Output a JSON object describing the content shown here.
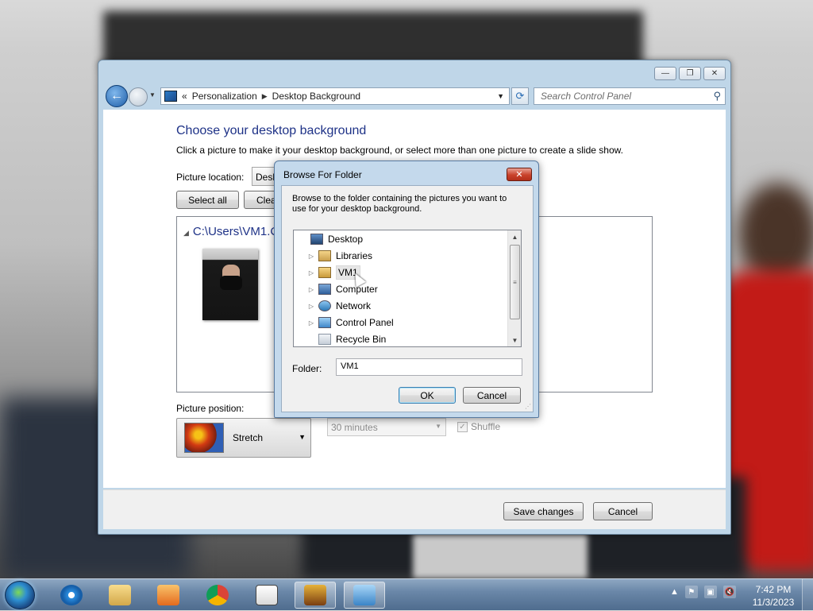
{
  "window": {
    "address": {
      "overflow": "«",
      "crumb1": "Personalization",
      "crumb2": "Desktop Background"
    },
    "search_placeholder": "Search Control Panel",
    "heading": "Choose your desktop background",
    "description": "Click a picture to make it your desktop background, or select more than one picture to create a slide show.",
    "picture_location_label": "Picture location:",
    "picture_location_value": "Desk",
    "select_all": "Select all",
    "clear_all": "Clea",
    "folder_path": "C:\\Users\\VM1.C",
    "picture_position_label": "Picture position:",
    "picture_position_value": "Stretch",
    "interval_value": "30 minutes",
    "shuffle_label": "Shuffle",
    "save_changes": "Save changes",
    "cancel": "Cancel"
  },
  "dialog": {
    "title": "Browse For Folder",
    "close": "✕",
    "description": "Browse to the folder containing the pictures you want to use for your desktop background.",
    "tree": [
      {
        "label": "Desktop",
        "icon": "desktop-icon"
      },
      {
        "label": "Libraries",
        "icon": "libraries-icon"
      },
      {
        "label": "VM1",
        "icon": "user-folder-icon"
      },
      {
        "label": "Computer",
        "icon": "computer-icon"
      },
      {
        "label": "Network",
        "icon": "network-icon"
      },
      {
        "label": "Control Panel",
        "icon": "control-panel-icon"
      },
      {
        "label": "Recycle Bin",
        "icon": "recycle-bin-icon"
      }
    ],
    "selected": "VM1",
    "folder_label": "Folder:",
    "folder_value": "VM1",
    "ok": "OK",
    "cancel": "Cancel"
  },
  "taskbar": {
    "time": "7:42 PM",
    "date": "11/3/2023"
  }
}
